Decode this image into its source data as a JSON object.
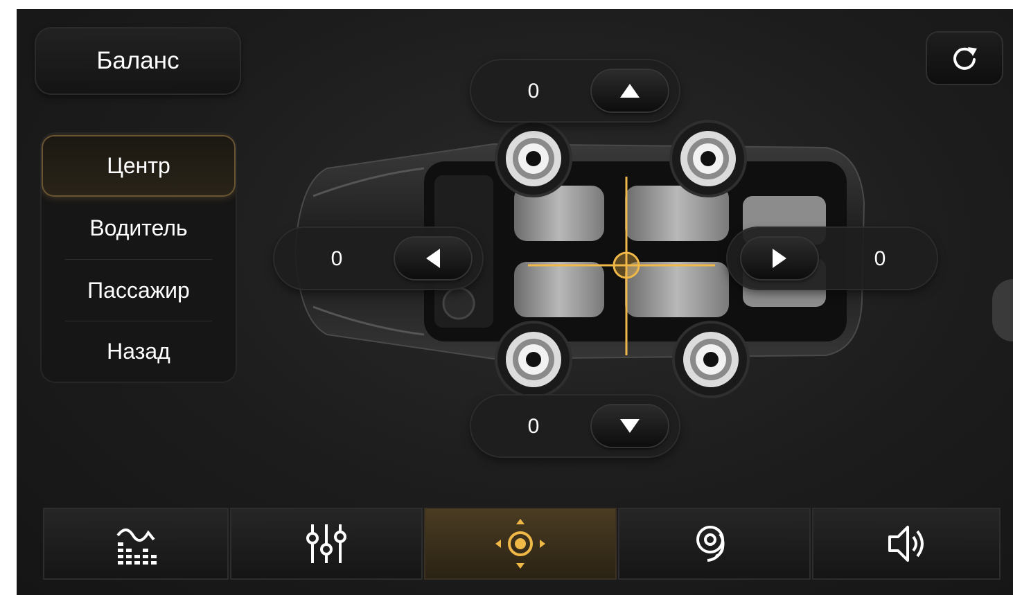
{
  "screen_title": "Баланс",
  "modes": [
    {
      "label": "Центр",
      "selected": true
    },
    {
      "label": "Водитель",
      "selected": false
    },
    {
      "label": "Пассажир",
      "selected": false
    },
    {
      "label": "Назад",
      "selected": false
    }
  ],
  "balance": {
    "front_value": "0",
    "rear_value": "0",
    "left_value": "0",
    "right_value": "0"
  },
  "icons": {
    "reset": "refresh-icon",
    "up": "arrow-up-icon",
    "down": "arrow-down-icon",
    "left": "arrow-left-icon",
    "right": "arrow-right-icon"
  },
  "bottom_tabs": [
    {
      "icon": "equalizer-curve-icon",
      "active": false
    },
    {
      "icon": "sliders-icon",
      "active": false
    },
    {
      "icon": "balance-crosshair-icon",
      "active": true
    },
    {
      "icon": "surround-sound-icon",
      "active": false
    },
    {
      "icon": "speaker-volume-icon",
      "active": false
    }
  ],
  "colors": {
    "accent": "#f0b847",
    "background": "#1c1c1c",
    "text": "#ffffff",
    "active_tab": "#3a2f1c"
  }
}
